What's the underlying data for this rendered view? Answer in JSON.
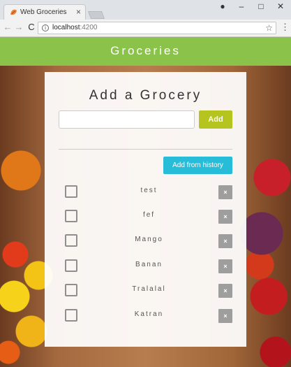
{
  "browser": {
    "tab_title": "Web Groceries",
    "tab_close": "×",
    "url_host": "localhost",
    "url_port": ":4200",
    "back": "←",
    "forward": "→",
    "reload": "C",
    "star": "☆",
    "menu": "⋮",
    "info": "i",
    "account": "●",
    "minimize": "–",
    "maximize": "□",
    "close": "✕"
  },
  "app": {
    "title": "Groceries",
    "close_icon": "close-x",
    "accent": "#8bc34a"
  },
  "card": {
    "heading": "Add a Grocery",
    "input_value": "",
    "add_label": "Add",
    "history_label": "Add from history",
    "delete_glyph": "×",
    "items": [
      {
        "name": "test",
        "checked": false
      },
      {
        "name": "fef",
        "checked": false
      },
      {
        "name": "Mango",
        "checked": false
      },
      {
        "name": "Banan",
        "checked": false
      },
      {
        "name": "Tralalal",
        "checked": false
      },
      {
        "name": "Katran",
        "checked": false
      }
    ]
  }
}
